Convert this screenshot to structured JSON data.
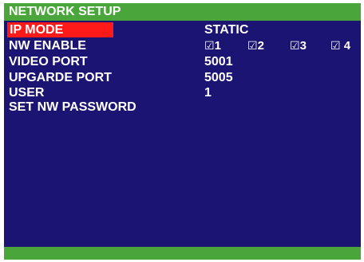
{
  "title": "NETWORK SETUP",
  "items": [
    {
      "label": "IP MODE",
      "value": "STATIC"
    },
    {
      "label": "NW ENABLE"
    },
    {
      "label": "VIDEO PORT",
      "value": "5001"
    },
    {
      "label": "UPGARDE PORT",
      "value": "5005"
    },
    {
      "label": "USER",
      "value": "1"
    },
    {
      "label": "SET NW PASSWORD"
    }
  ],
  "nw_enable": [
    {
      "box": "☑",
      "text": "1"
    },
    {
      "box": "☑",
      "text": "2"
    },
    {
      "box": "☑",
      "text": "3"
    },
    {
      "box": "☑",
      "text": " 4"
    }
  ],
  "colors": {
    "background": "#1c1473",
    "bars": "#4aa63a",
    "highlight": "#ff1a1a",
    "text": "#ffffff"
  }
}
